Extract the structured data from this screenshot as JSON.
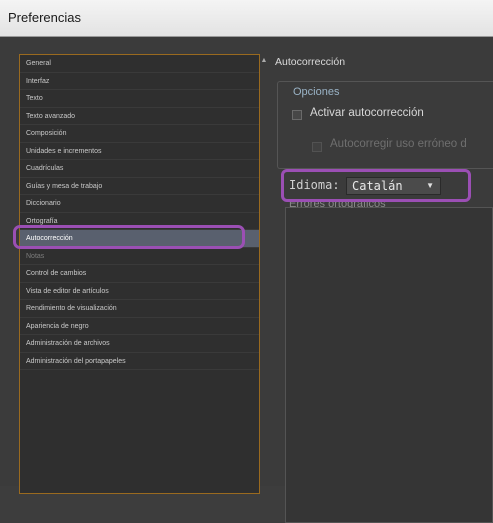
{
  "window": {
    "title": "Preferencias"
  },
  "categories": {
    "items": [
      "General",
      "Interfaz",
      "Texto",
      "Texto avanzado",
      "Composición",
      "Unidades e incrementos",
      "Cuadrículas",
      "Guías y mesa de trabajo",
      "Diccionario",
      "Ortografía",
      "Autocorrección",
      "Notas",
      "Control de cambios",
      "Vista de editor de artículos",
      "Rendimiento de visualización",
      "Apariencia de negro",
      "Administración de archivos",
      "Administración del portapapeles"
    ],
    "selected": "Autocorrección"
  },
  "panel": {
    "title": "Autocorrección",
    "options_group_title": "Opciones",
    "enable_autocorrect_label": "Activar autocorrección",
    "autocorrect_caps_label": "Autocorregir uso erróneo d",
    "language_label": "Idioma:",
    "language_value": "Catalán",
    "autocorrect_list_label": "Errores ortográficos"
  },
  "colors": {
    "highlight": "#9b4fb4",
    "selection": "#59606e"
  }
}
